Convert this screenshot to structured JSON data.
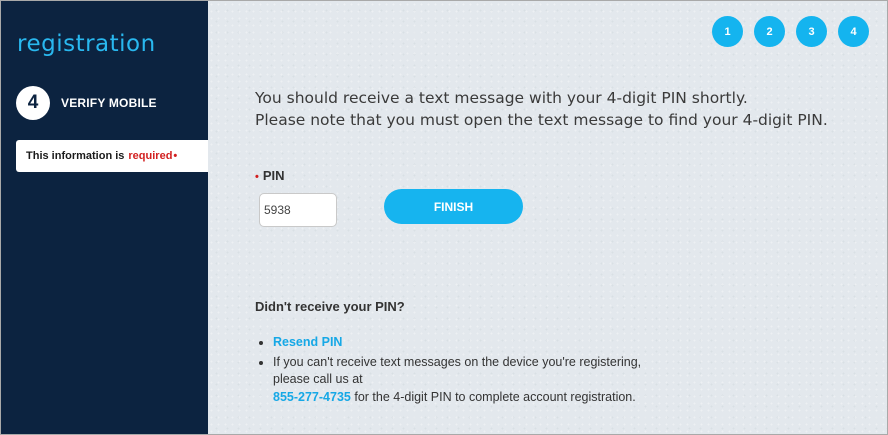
{
  "sidebar": {
    "brand": "registration",
    "step_number": "4",
    "step_label": "VERIFY MOBILE",
    "required_prefix": "This information is",
    "required_word": "required",
    "required_marker": "•"
  },
  "progress": {
    "steps": [
      "1",
      "2",
      "3",
      "4"
    ]
  },
  "main": {
    "message_line1": "You should receive a text message with your 4-digit PIN shortly.",
    "message_line2": "Please note that you must open the text message to find your 4-digit PIN.",
    "pin_marker": "•",
    "pin_label": "PIN",
    "pin_value": "5938",
    "finish_label": "FINISH",
    "help_title": "Didn't receive your PIN?",
    "resend_label": "Resend PIN",
    "help_text_1": "If you can't receive text messages on the device you're registering,",
    "help_text_2": "please call us at",
    "phone": "855-277-4735",
    "help_text_3": "for the 4-digit PIN to complete account registration."
  },
  "colors": {
    "sidebar_bg": "#0c2340",
    "accent": "#16b4ef",
    "required": "#d21f1f"
  }
}
